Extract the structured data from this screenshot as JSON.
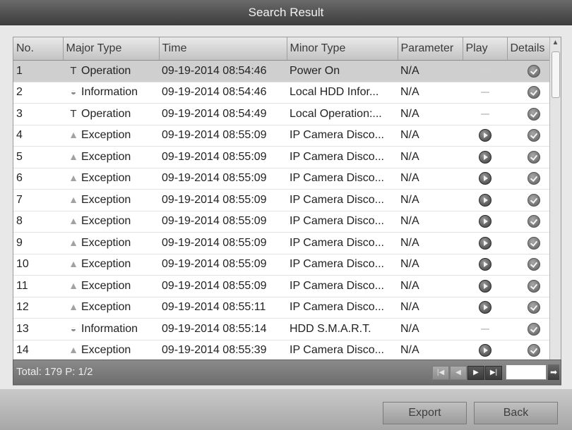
{
  "window": {
    "title": "Search Result"
  },
  "table": {
    "columns": [
      "No.",
      "Major Type",
      "Time",
      "Minor Type",
      "Parameter",
      "Play",
      "Details"
    ],
    "rows": [
      {
        "no": "1",
        "major": "Operation",
        "icon": "operation-icon",
        "time": "09-19-2014 08:54:46",
        "minor": "Power On",
        "param": "N/A",
        "play": false
      },
      {
        "no": "2",
        "major": "Information",
        "icon": "information-icon",
        "time": "09-19-2014 08:54:46",
        "minor": "Local HDD Infor...",
        "param": "N/A",
        "play": false
      },
      {
        "no": "3",
        "major": "Operation",
        "icon": "operation-icon",
        "time": "09-19-2014 08:54:49",
        "minor": "Local Operation:...",
        "param": "N/A",
        "play": false
      },
      {
        "no": "4",
        "major": "Exception",
        "icon": "exception-icon",
        "time": "09-19-2014 08:55:09",
        "minor": "IP Camera Disco...",
        "param": "N/A",
        "play": true
      },
      {
        "no": "5",
        "major": "Exception",
        "icon": "exception-icon",
        "time": "09-19-2014 08:55:09",
        "minor": "IP Camera Disco...",
        "param": "N/A",
        "play": true
      },
      {
        "no": "6",
        "major": "Exception",
        "icon": "exception-icon",
        "time": "09-19-2014 08:55:09",
        "minor": "IP Camera Disco...",
        "param": "N/A",
        "play": true
      },
      {
        "no": "7",
        "major": "Exception",
        "icon": "exception-icon",
        "time": "09-19-2014 08:55:09",
        "minor": "IP Camera Disco...",
        "param": "N/A",
        "play": true
      },
      {
        "no": "8",
        "major": "Exception",
        "icon": "exception-icon",
        "time": "09-19-2014 08:55:09",
        "minor": "IP Camera Disco...",
        "param": "N/A",
        "play": true
      },
      {
        "no": "9",
        "major": "Exception",
        "icon": "exception-icon",
        "time": "09-19-2014 08:55:09",
        "minor": "IP Camera Disco...",
        "param": "N/A",
        "play": true
      },
      {
        "no": "10",
        "major": "Exception",
        "icon": "exception-icon",
        "time": "09-19-2014 08:55:09",
        "minor": "IP Camera Disco...",
        "param": "N/A",
        "play": true
      },
      {
        "no": "11",
        "major": "Exception",
        "icon": "exception-icon",
        "time": "09-19-2014 08:55:09",
        "minor": "IP Camera Disco...",
        "param": "N/A",
        "play": true
      },
      {
        "no": "12",
        "major": "Exception",
        "icon": "exception-icon",
        "time": "09-19-2014 08:55:11",
        "minor": "IP Camera Disco...",
        "param": "N/A",
        "play": true
      },
      {
        "no": "13",
        "major": "Information",
        "icon": "information-icon",
        "time": "09-19-2014 08:55:14",
        "minor": "HDD S.M.A.R.T.",
        "param": "N/A",
        "play": false
      },
      {
        "no": "14",
        "major": "Exception",
        "icon": "exception-icon",
        "time": "09-19-2014 08:55:39",
        "minor": "IP Camera Disco...",
        "param": "N/A",
        "play": true
      }
    ]
  },
  "footer": {
    "total_text": "Total: 179  P: 1/2",
    "page_input_value": ""
  },
  "buttons": {
    "export": "Export",
    "back": "Back"
  }
}
